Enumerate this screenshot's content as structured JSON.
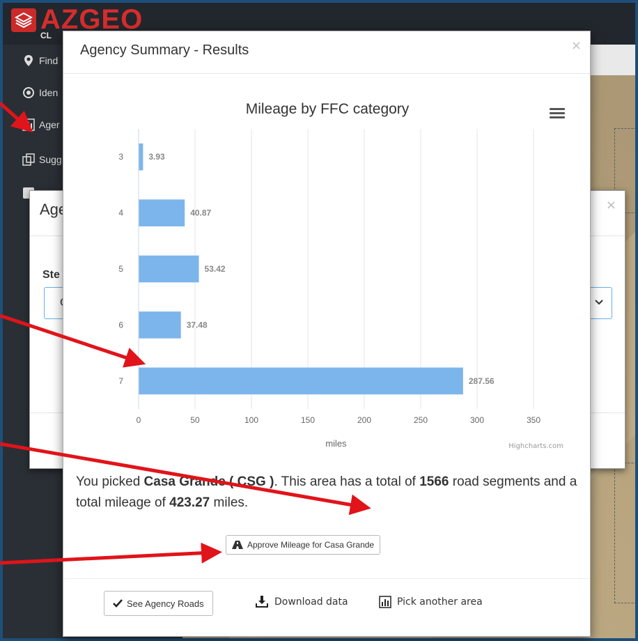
{
  "app": {
    "logo_text": "AZGEO",
    "logo_sub": "CL"
  },
  "sidebar": {
    "items": [
      {
        "label": "Find",
        "icon": "map-marker-icon"
      },
      {
        "label": "Iden",
        "icon": "target-icon"
      },
      {
        "label": "Ager",
        "icon": "bar-chart-icon"
      },
      {
        "label": "Sugg",
        "icon": "copy-icon"
      }
    ]
  },
  "background_modal": {
    "title": "Age",
    "step_label": "Ste",
    "select_value": "C",
    "close_label": "×"
  },
  "modal": {
    "title": "Agency Summary - Results",
    "close_label": "×",
    "summary": {
      "prefix": "You picked ",
      "agency": "Casa Grande ( CSG )",
      "middle": ". This area has a total of ",
      "segments": "1566",
      "middle2": " road segments and a total mileage of ",
      "mileage": "423.27",
      "suffix": " miles."
    },
    "approve_label": "Approve Mileage for Casa Grande",
    "see_roads_label": "See Agency Roads",
    "download_label": "Download data",
    "pick_label": "Pick another area"
  },
  "chart_data": {
    "type": "bar",
    "orientation": "horizontal",
    "title": "Mileage by FFC category",
    "categories": [
      "3",
      "4",
      "5",
      "6",
      "7"
    ],
    "values": [
      3.93,
      40.87,
      53.42,
      37.48,
      287.56
    ],
    "value_labels": [
      "3.93",
      "40.87",
      "53.42",
      "37.48",
      "287.56"
    ],
    "xlabel": "miles",
    "ylabel": "",
    "xlim": [
      0,
      350
    ],
    "x_ticks": [
      "0",
      "50",
      "100",
      "150",
      "200",
      "250",
      "300",
      "350"
    ],
    "grid": true,
    "bar_color": "#7cb5ec",
    "credit": "Highcharts.com"
  },
  "colors": {
    "arrow": "#e0141a",
    "accent": "#66afe9"
  }
}
